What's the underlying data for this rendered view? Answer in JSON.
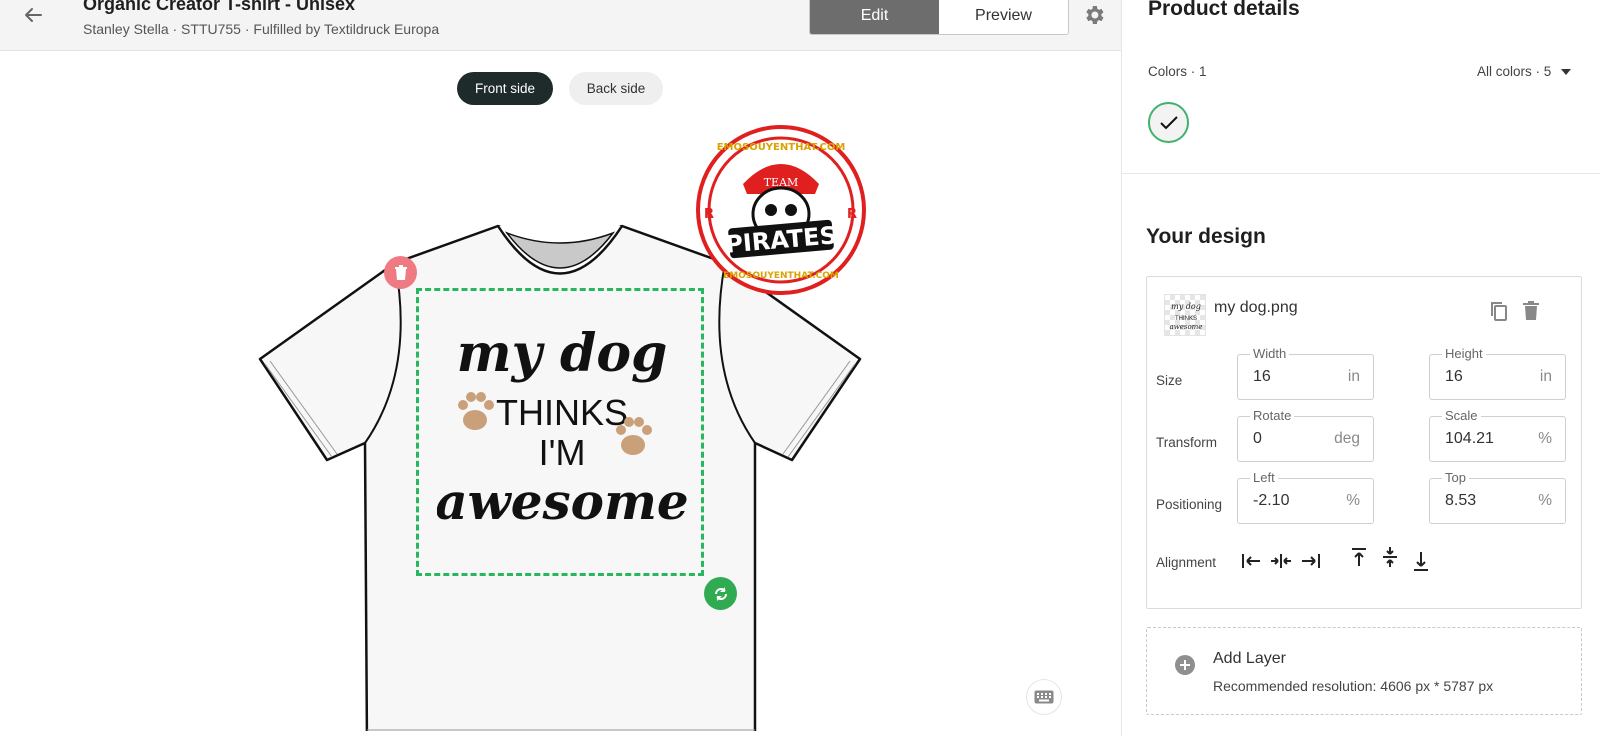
{
  "header": {
    "title": "Organic Creator T-shirt - Unisex",
    "subtitle": "Stanley Stella · STTU755 · Fulfilled by Textildruck Europa",
    "modes": [
      "Edit",
      "Preview"
    ],
    "active_mode": "Edit"
  },
  "canvas": {
    "sides": {
      "front": "Front side",
      "back": "Back side"
    },
    "active_side": "Front side",
    "design_text": {
      "line1": "my dog",
      "line2": "THINKS",
      "line3": "I'M",
      "line4": "awesome"
    },
    "watermark": {
      "top_text": "EMOSOUYENTHAT.COM",
      "banner": "PIRATES",
      "cap_text": "TEAM",
      "mark": "R"
    },
    "accent_color": "#29b75d"
  },
  "panel": {
    "product_details_title": "Product details",
    "colors_label": "Colors · 1",
    "all_colors_label": "All colors · 5",
    "selected_color": "#f3f3f3",
    "your_design_title": "Your design",
    "layer": {
      "name": "my dog.png",
      "size_label": "Size",
      "transform_label": "Transform",
      "positioning_label": "Positioning",
      "alignment_label": "Alignment",
      "width": {
        "label": "Width",
        "value": "16",
        "unit": "in"
      },
      "height": {
        "label": "Height",
        "value": "16",
        "unit": "in"
      },
      "rotate": {
        "label": "Rotate",
        "value": "0",
        "unit": "deg"
      },
      "scale": {
        "label": "Scale",
        "value": "104.21",
        "unit": "%"
      },
      "left": {
        "label": "Left",
        "value": "-2.10",
        "unit": "%"
      },
      "top": {
        "label": "Top",
        "value": "8.53",
        "unit": "%"
      }
    },
    "add_layer": {
      "title": "Add Layer",
      "hint": "Recommended resolution: 4606 px * 5787 px"
    }
  }
}
